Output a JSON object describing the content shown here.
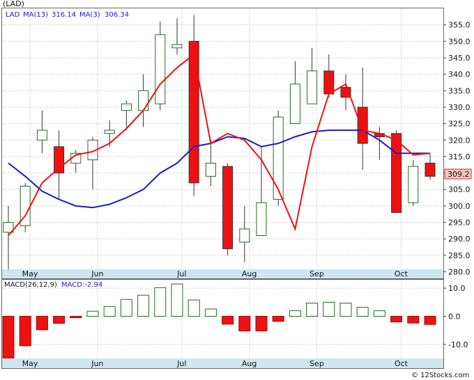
{
  "chart_data": [
    {
      "type": "candlestick",
      "title": "(LAD)",
      "legend": {
        "symbol": "LAD",
        "ma13_label": "MA(13)",
        "ma13_value": "316.14",
        "ma3_label": "MA(3)",
        "ma3_value": "306.34"
      },
      "last_price_label": "309.2",
      "ylim": [
        278,
        360
      ],
      "y_ticks": [
        "280.0",
        "285.0",
        "290.0",
        "295.0",
        "300.0",
        "305.0",
        "310.0",
        "315.0",
        "320.0",
        "325.0",
        "330.0",
        "335.0",
        "340.0",
        "345.0",
        "350.0",
        "355.0"
      ],
      "x_month_labels": [
        {
          "label": "May",
          "index": 1.2
        },
        {
          "label": "Jun",
          "index": 5.2
        },
        {
          "label": "Jul",
          "index": 10.2
        },
        {
          "label": "Aug",
          "index": 14.2
        },
        {
          "label": "Sep",
          "index": 18.2
        },
        {
          "label": "Oct",
          "index": 23.2
        }
      ],
      "candles": [
        {
          "o": 292,
          "h": 300,
          "l": 280,
          "c": 295
        },
        {
          "o": 294,
          "h": 307,
          "l": 292,
          "c": 306
        },
        {
          "o": 320,
          "h": 329,
          "l": 316,
          "c": 323
        },
        {
          "o": 318,
          "h": 323,
          "l": 302,
          "c": 310
        },
        {
          "o": 313,
          "h": 317,
          "l": 310,
          "c": 316
        },
        {
          "o": 314,
          "h": 321,
          "l": 305,
          "c": 320
        },
        {
          "o": 322,
          "h": 326,
          "l": 318,
          "c": 323
        },
        {
          "o": 329,
          "h": 332,
          "l": 323,
          "c": 331
        },
        {
          "o": 329,
          "h": 340,
          "l": 324,
          "c": 335
        },
        {
          "o": 331,
          "h": 356,
          "l": 329,
          "c": 352
        },
        {
          "o": 348,
          "h": 357,
          "l": 346,
          "c": 349
        },
        {
          "o": 350,
          "h": 358,
          "l": 303,
          "c": 307
        },
        {
          "o": 309,
          "h": 320,
          "l": 306,
          "c": 313
        },
        {
          "o": 312,
          "h": 313,
          "l": 285,
          "c": 287
        },
        {
          "o": 289,
          "h": 300,
          "l": 283,
          "c": 293
        },
        {
          "o": 291,
          "h": 318,
          "l": 291,
          "c": 301
        },
        {
          "o": 302,
          "h": 329,
          "l": 300,
          "c": 327
        },
        {
          "o": 325,
          "h": 344,
          "l": 325,
          "c": 337
        },
        {
          "o": 331,
          "h": 348,
          "l": 331,
          "c": 341
        },
        {
          "o": 341,
          "h": 346,
          "l": 333,
          "c": 334
        },
        {
          "o": 336,
          "h": 340,
          "l": 329,
          "c": 333
        },
        {
          "o": 330,
          "h": 342,
          "l": 311,
          "c": 319
        },
        {
          "o": 322,
          "h": 324,
          "l": 314,
          "c": 321
        },
        {
          "o": 322,
          "h": 323,
          "l": 298,
          "c": 298
        },
        {
          "o": 301,
          "h": 314,
          "l": 300,
          "c": 312
        },
        {
          "o": 313,
          "h": 316,
          "l": 308,
          "c": 309
        }
      ],
      "ma13": [
        291,
        297,
        307,
        311.5,
        315.5,
        316.5,
        319,
        323.5,
        329,
        337,
        342,
        346,
        319,
        322,
        320,
        314,
        305,
        293,
        318,
        334,
        337,
        323,
        322,
        320,
        315.5,
        316
      ],
      "ma3": [
        313,
        309,
        304.5,
        302,
        300,
        299.5,
        300.5,
        302.5,
        305,
        310,
        313,
        318,
        319,
        321,
        320.5,
        318,
        319,
        321,
        322.5,
        323,
        323,
        323,
        320,
        316,
        316,
        316
      ],
      "ma3_plot_from": 0,
      "ma13_overrides": [],
      "macd": {
        "label": "MACD(26,12,9)",
        "value_label": "MACD:-2.94",
        "ylim": [
          -15,
          13
        ],
        "y_ticks": [
          "10.0",
          "0.0",
          "-10.0"
        ],
        "bars": [
          -15,
          -10.5,
          -4.8,
          -2.5,
          -0.5,
          1.8,
          3.5,
          6.0,
          7.5,
          10.2,
          11.5,
          5.8,
          2.6,
          -2.8,
          -5.2,
          -5.2,
          -1.8,
          2.0,
          4.7,
          5.0,
          4.7,
          3.2,
          2.0,
          -2.0,
          -2.4,
          -2.9
        ]
      },
      "grid": true,
      "watermark": "© 12Stocks.com"
    }
  ]
}
